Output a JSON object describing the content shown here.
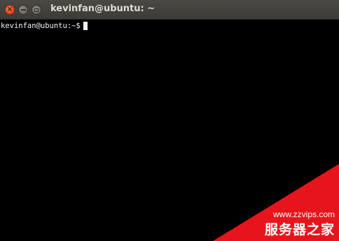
{
  "window": {
    "title": "kevinfan@ubuntu: ~",
    "buttons": {
      "close": "close-icon",
      "minimize": "minimize-icon",
      "maximize": "maximize-icon"
    }
  },
  "terminal": {
    "prompt": "kevinfan@ubuntu:~$"
  },
  "watermark": {
    "url": "www.zzvips.com",
    "text": "服务器之家",
    "color": "#e8141c"
  }
}
